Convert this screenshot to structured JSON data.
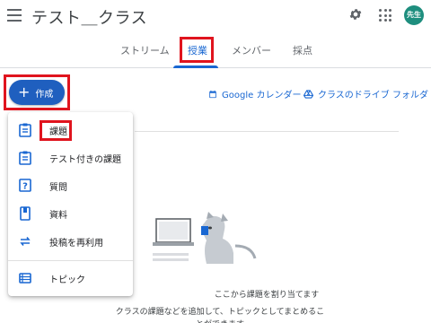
{
  "header": {
    "class_title": "テスト＿クラス",
    "avatar_text": "先生"
  },
  "tabs": [
    {
      "label": "ストリーム"
    },
    {
      "label": "授業",
      "active": true
    },
    {
      "label": "メンバー"
    },
    {
      "label": "採点"
    }
  ],
  "create_button": {
    "label": "作成"
  },
  "links": {
    "calendar": "Google カレンダー",
    "drive": "クラスのドライブ フォルダ"
  },
  "create_menu": {
    "items": [
      {
        "label": "課題",
        "icon": "assignment-icon"
      },
      {
        "label": "テスト付きの課題",
        "icon": "quiz-assignment-icon"
      },
      {
        "label": "質問",
        "icon": "question-icon"
      },
      {
        "label": "資料",
        "icon": "material-icon"
      },
      {
        "label": "投稿を再利用",
        "icon": "reuse-icon"
      },
      {
        "label": "トピック",
        "icon": "topic-icon"
      }
    ]
  },
  "empty_state": {
    "line1": "ここから課題を割り当てます",
    "line2": "クラスの課題などを追加して、トピックとしてまとめることができます"
  },
  "colors": {
    "accent_blue": "#1967d2",
    "create_button": "#1f5fbf",
    "avatar_bg": "#1e8e7e",
    "highlight_red": "#e0141e"
  }
}
